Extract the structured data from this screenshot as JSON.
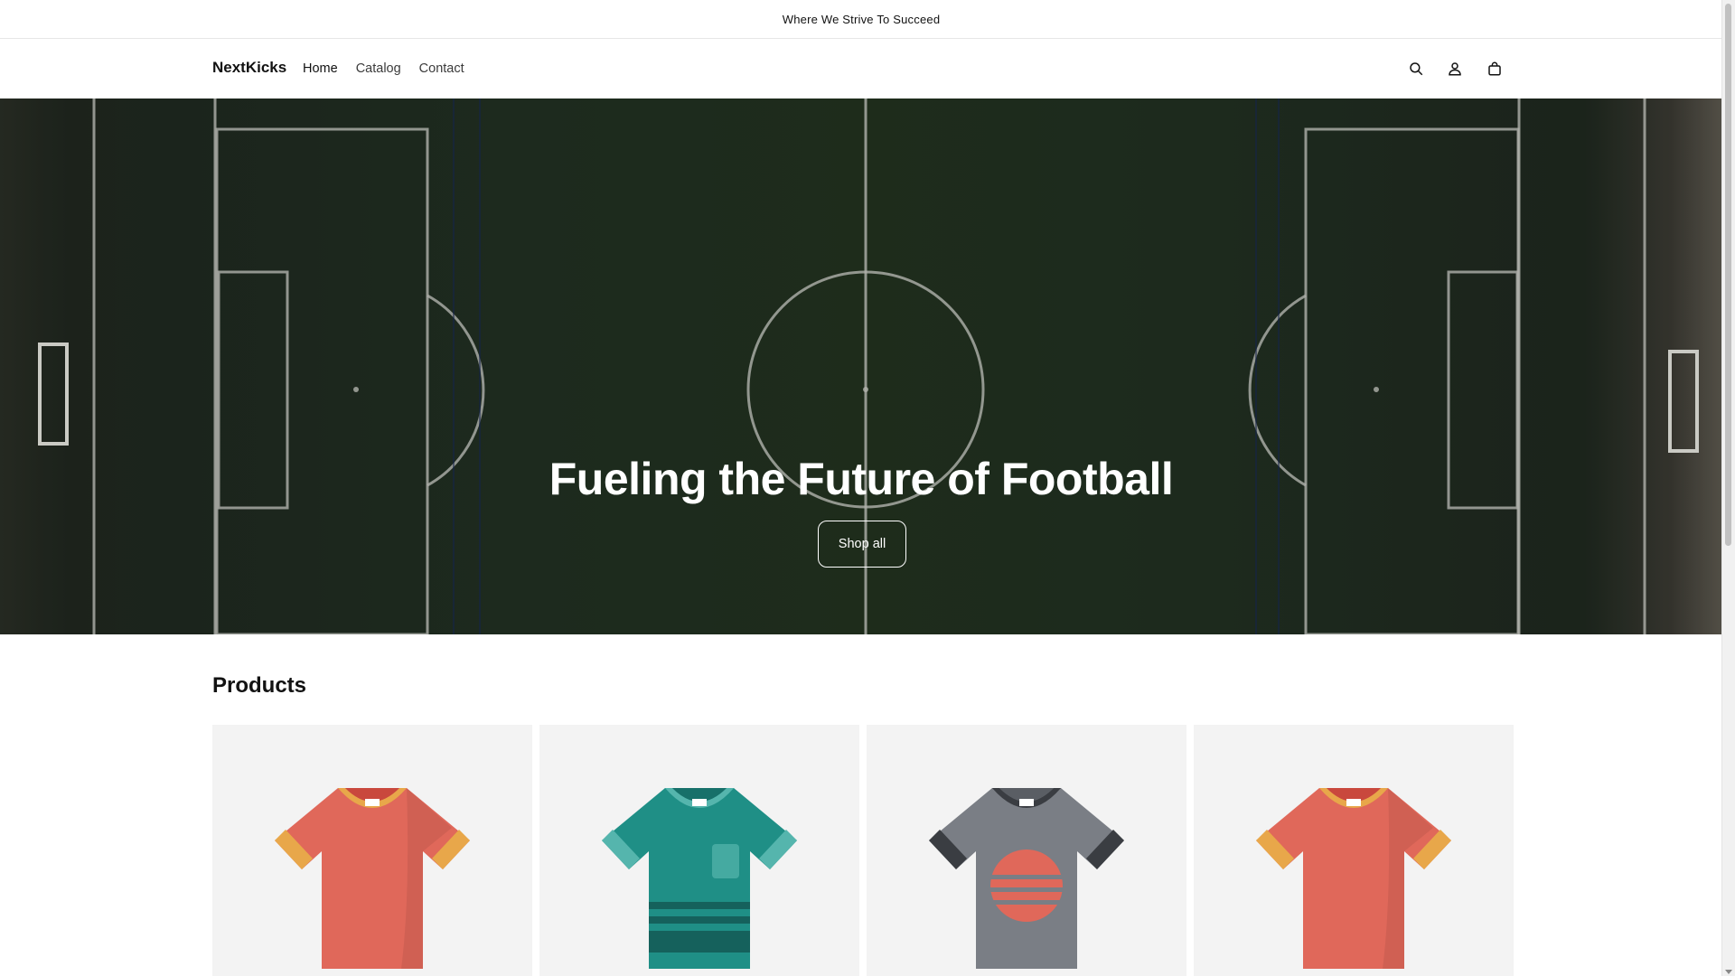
{
  "announcement": {
    "text": "Where We Strive To Succeed"
  },
  "header": {
    "logo": "NextKicks",
    "nav": [
      {
        "label": "Home"
      },
      {
        "label": "Catalog"
      },
      {
        "label": "Contact"
      }
    ],
    "icons": [
      "search-icon",
      "account-icon",
      "cart-icon"
    ]
  },
  "hero": {
    "title": "Fueling the Future of Football",
    "button_label": "Shop all"
  },
  "products": {
    "heading": "Products",
    "items": [
      {
        "image": "tshirt-icon",
        "color": "#e0685a",
        "trim": "#e8a74a"
      },
      {
        "image": "tshirt-icon",
        "color": "#1f8f86",
        "trim": "#55b5ad"
      },
      {
        "image": "tshirt-icon",
        "color": "#7a7e85",
        "trim": "#3a3d42"
      },
      {
        "image": "tshirt-icon",
        "color": "#e0685a",
        "trim": "#e8a74a"
      }
    ]
  },
  "colors": {
    "text": "#121212",
    "card_bg": "#f3f3f3",
    "pitch": "#213023"
  }
}
